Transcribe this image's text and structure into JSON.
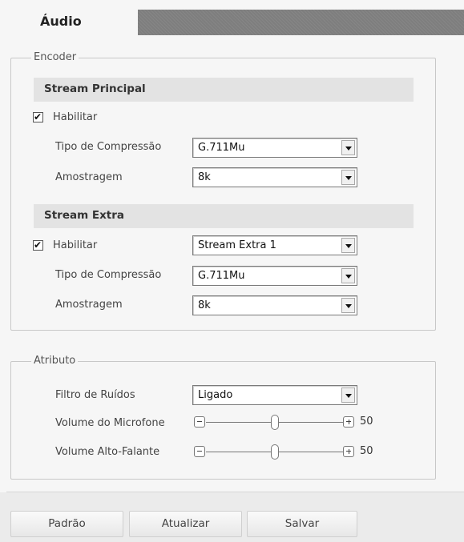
{
  "tab": {
    "active_label": "Áudio"
  },
  "encoder": {
    "legend": "Encoder",
    "principal": {
      "title": "Stream Principal",
      "enable_label": "Habilitar",
      "enabled": true,
      "compression_label": "Tipo de Compressão",
      "compression_value": "G.711Mu",
      "sampling_label": "Amostragem",
      "sampling_value": "8k"
    },
    "extra": {
      "title": "Stream Extra",
      "enable_label": "Habilitar",
      "enabled": true,
      "stream_value": "Stream Extra 1",
      "compression_label": "Tipo de Compressão",
      "compression_value": "G.711Mu",
      "sampling_label": "Amostragem",
      "sampling_value": "8k"
    }
  },
  "atributo": {
    "legend": "Atributo",
    "noise_filter_label": "Filtro de Ruídos",
    "noise_filter_value": "Ligado",
    "mic_volume_label": "Volume do Microfone",
    "mic_volume_value": "50",
    "speaker_volume_label": "Volume Alto-Falante",
    "speaker_volume_value": "50"
  },
  "buttons": {
    "default_label": "Padrão",
    "refresh_label": "Atualizar",
    "save_label": "Salvar"
  },
  "icons": {
    "dropdown": "chevron-down-icon",
    "checkbox": "check-icon",
    "minus": "minus-icon",
    "plus": "plus-icon"
  },
  "colors": {
    "tab_inactive_bar": "#7e7e7e",
    "section_header_bg": "#e3e3e3",
    "page_bg": "#f6f6f6"
  }
}
